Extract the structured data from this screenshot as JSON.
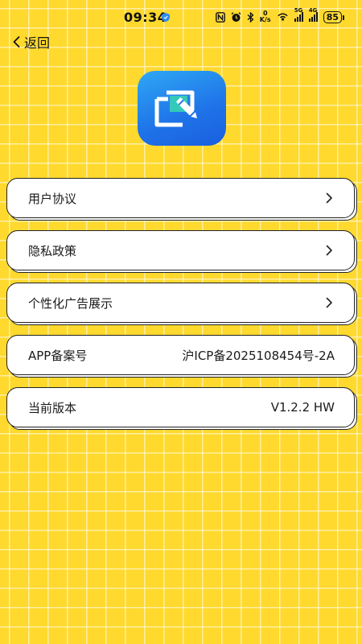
{
  "status_bar": {
    "time": "09:34",
    "net_speed_value": "0",
    "net_speed_unit": "K/s",
    "signal1_label": "5G",
    "signal2_label": "4G",
    "battery": "85",
    "icons": [
      "nfc-icon",
      "alarm-icon",
      "bluetooth-icon",
      "network-speed-icon",
      "hotspot-icon",
      "signal-5g-icon",
      "signal-4g-icon",
      "battery-icon"
    ]
  },
  "nav": {
    "back_label": "返回"
  },
  "logo": {
    "icon": "edit-document-icon",
    "gradient_from": "#2EA8F4",
    "gradient_to": "#1A5FE0"
  },
  "menu": {
    "items": [
      {
        "label": "用户协议",
        "value": "",
        "chevron": true
      },
      {
        "label": "隐私政策",
        "value": "",
        "chevron": true
      },
      {
        "label": "个性化广告展示",
        "value": "",
        "chevron": true
      },
      {
        "label": "APP备案号",
        "value": "沪ICP备2025108454号-2A",
        "chevron": false
      },
      {
        "label": "当前版本",
        "value": "V1.2.2 HW",
        "chevron": false
      }
    ]
  },
  "theme": {
    "background": "#FFD92E",
    "grid_line": "#FFFFFF",
    "card_bg": "#FFFFFF",
    "card_border": "#222222"
  }
}
